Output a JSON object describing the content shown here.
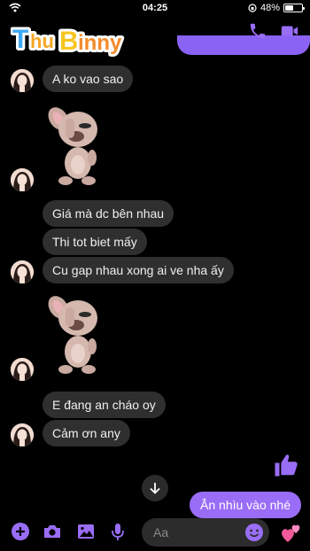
{
  "status_bar": {
    "time": "04:25",
    "battery_percent": 48,
    "battery_label": "48%"
  },
  "header": {
    "logo_text": "ThuBinny",
    "call_icon": "phone-icon",
    "video_icon": "video-camera-icon"
  },
  "messages": [
    {
      "type": "text",
      "text": "A ko vao sao"
    },
    {
      "type": "sticker",
      "sticker": "bunny-facepalm-sticker"
    },
    {
      "type": "text",
      "text": "Giá mà dc bên nhau"
    },
    {
      "type": "text",
      "text": "Thi tot biet mấy"
    },
    {
      "type": "text",
      "text": "Cu gap nhau xong ai ve nha ấy"
    },
    {
      "type": "sticker",
      "sticker": "bunny-facepalm-sticker"
    },
    {
      "type": "text",
      "text": "E đang an cháo oy"
    },
    {
      "type": "text",
      "text": "Cảm ơn any"
    }
  ],
  "outgoing": {
    "text": "Ẳn nhìu vào nhé",
    "reaction": "thumbs-up-icon"
  },
  "composer": {
    "placeholder": "Aa",
    "icons": [
      "plus-icon",
      "camera-icon",
      "image-icon",
      "microphone-icon",
      "emoji-icon",
      "hearts-icon"
    ]
  },
  "colors": {
    "accent": "#9a6df7",
    "bubble_in": "#2f2f2f",
    "background": "#000000"
  }
}
